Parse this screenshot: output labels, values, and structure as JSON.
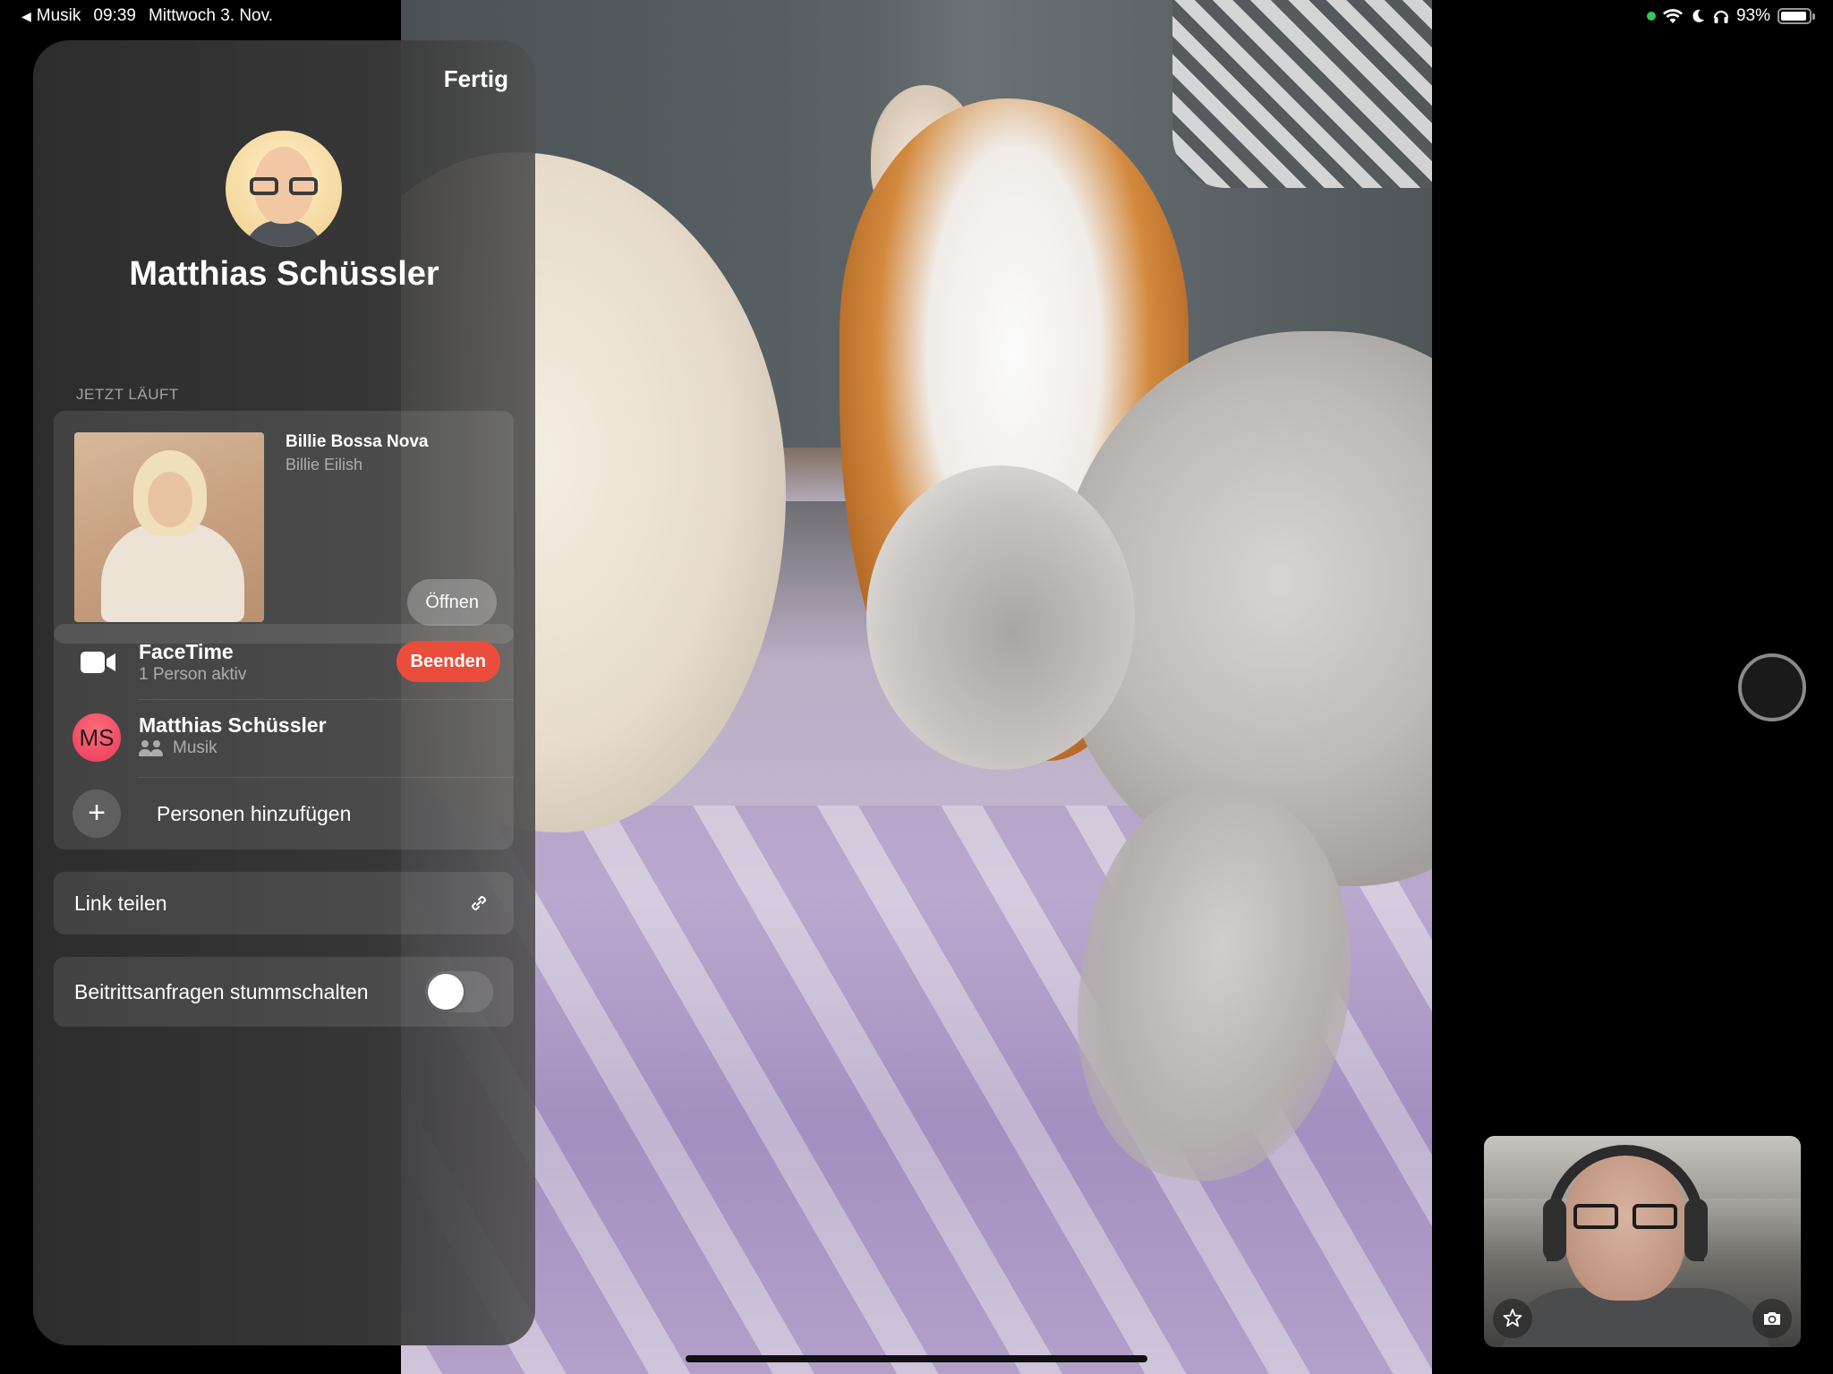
{
  "status_bar": {
    "back_app": "Musik",
    "time": "09:39",
    "date": "Mittwoch 3. Nov.",
    "battery_percent": "93%",
    "battery_level": 0.93,
    "icons": [
      "green-dot",
      "wifi-icon",
      "moon-icon",
      "headphones-icon",
      "battery-icon"
    ]
  },
  "panel": {
    "done_label": "Fertig",
    "contact_name": "Matthias Schüssler",
    "now_playing": {
      "section_label": "JETZT LÄUFT",
      "song_title": "Billie Bossa Nova",
      "artist": "Billie Eilish",
      "open_label": "Öffnen"
    },
    "call": {
      "title": "FaceTime",
      "subtitle": "1 Person aktiv",
      "end_label": "Beenden",
      "member": {
        "initials": "MS",
        "name": "Matthias Schüssler",
        "activity": "Musik"
      },
      "add_people_label": "Personen hinzufügen"
    },
    "share_link_label": "Link teilen",
    "mute_requests": {
      "label": "Beitrittsanfragen stummschalten",
      "enabled": false
    }
  },
  "colors": {
    "end_button": "#eb4d3d",
    "member_avatar": "#e83a58",
    "status_dot": "#34c759"
  }
}
